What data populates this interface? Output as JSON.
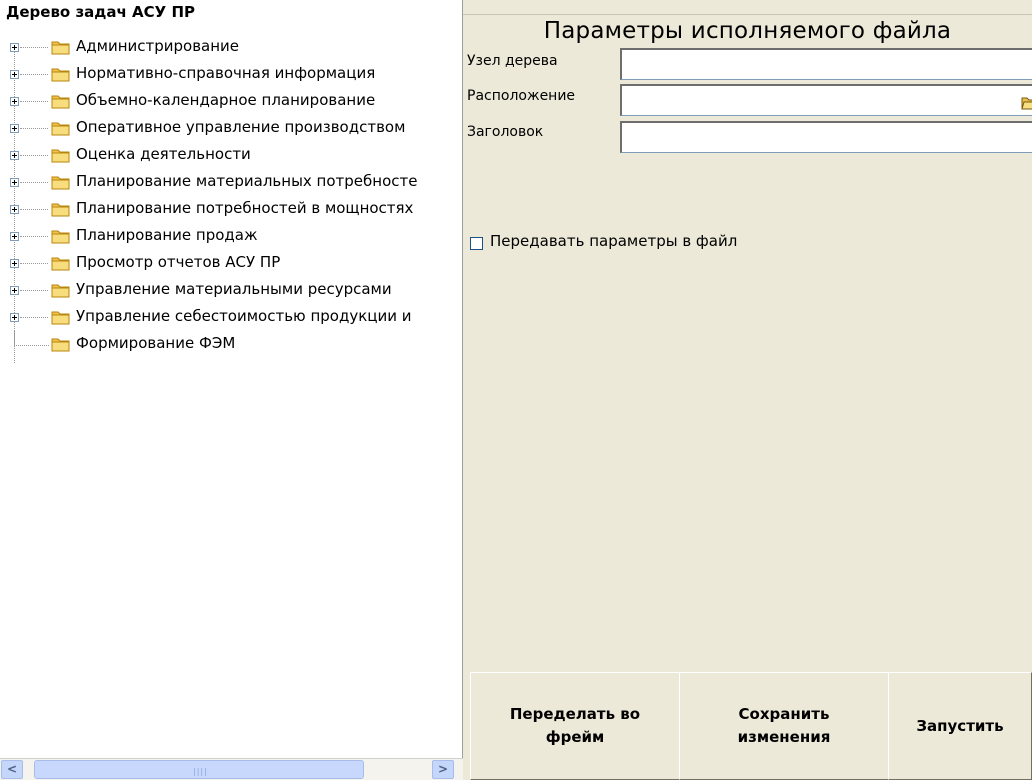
{
  "tree": {
    "title": "Дерево задач АСУ ПР",
    "items": [
      {
        "label": "Администрирование",
        "expandable": true
      },
      {
        "label": "Нормативно-справочная информация",
        "expandable": true
      },
      {
        "label": "Объемно-календарное планирование",
        "expandable": true
      },
      {
        "label": "Оперативное управление производством",
        "expandable": true
      },
      {
        "label": "Оценка деятельности",
        "expandable": true
      },
      {
        "label": "Планирование материальных потребносте",
        "expandable": true
      },
      {
        "label": "Планирование потребностей в мощностях",
        "expandable": true
      },
      {
        "label": "Планирование продаж",
        "expandable": true
      },
      {
        "label": "Просмотр отчетов АСУ ПР",
        "expandable": true
      },
      {
        "label": "Управление материальными ресурсами",
        "expandable": true
      },
      {
        "label": "Управление себестоимостью продукции и",
        "expandable": true
      },
      {
        "label": "Формирование ФЭМ",
        "expandable": false
      }
    ],
    "scroll_left_icon": "arrow-left-icon",
    "scroll_right_icon": "arrow-right-icon"
  },
  "form": {
    "title": "Параметры исполняемого файла",
    "node_label": "Узел дерева",
    "node_value": "",
    "location_label": "Расположение",
    "location_value": "",
    "location_browse_icon": "open-folder-icon",
    "caption_label": "Заголовок",
    "caption_value": "",
    "pass_params_label": "Передавать параметры в файл",
    "pass_params_checked": false
  },
  "buttons": {
    "to_frame": "Переделать во фрейм",
    "save": "Сохранить изменения",
    "run": "Запустить"
  },
  "colors": {
    "background": "#ece9d8",
    "tree_background": "#ffffff",
    "folder": "#f5d36b",
    "scrollbar": "#c5d6fb"
  }
}
